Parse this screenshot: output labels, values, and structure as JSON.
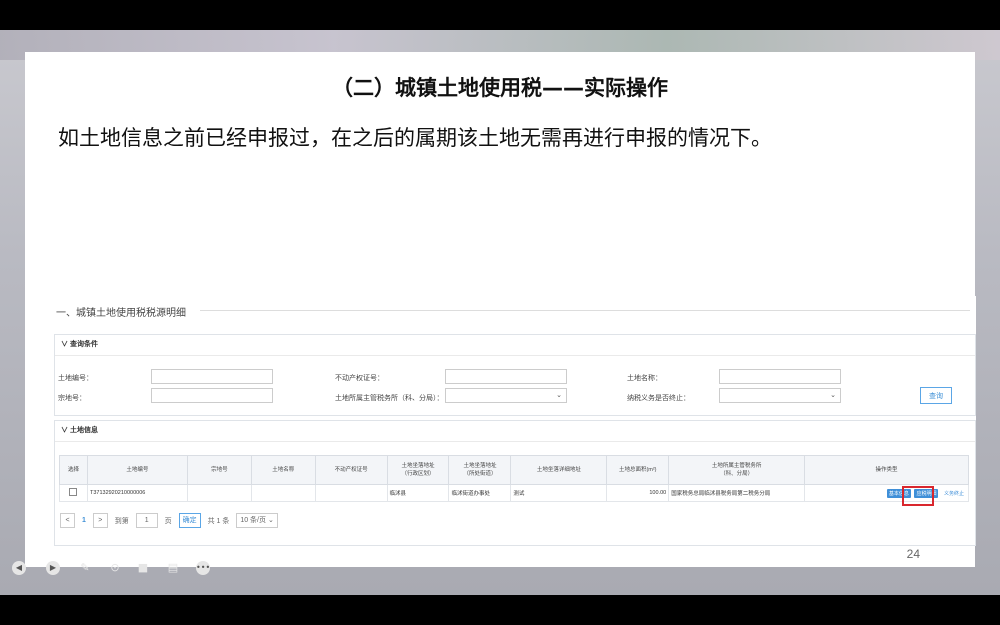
{
  "slide": {
    "title": "（二）城镇土地使用税——实际操作",
    "subtitle": "如土地信息之前已经申报过，在之后的属期该土地无需再进行申报的情况下。",
    "page_number": "24"
  },
  "screenshot": {
    "section_title": "一、城镇土地使用税税源明细",
    "query_panel": {
      "header": "∨ 查询条件",
      "labels": {
        "land_no": "土地编号：",
        "cert_no": "不动产权证号：",
        "land_name": "土地名称：",
        "parcel_no": "宗地号：",
        "tax_office": "土地所属主管税务所（科、分局）：",
        "tax_stopped": "纳税义务是否终止："
      },
      "query_button": "查询"
    },
    "land_panel": {
      "header": "∨ 土地信息",
      "columns": [
        "选择",
        "土地编号",
        "宗地号",
        "土地名称",
        "不动产权证号",
        "土地坐落地址\n（行政区划）",
        "土地坐落地址\n（所处街道）",
        "土地坐落详细地址",
        "土地总面积(m²)",
        "土地所属主管税务所\n（科、分局）",
        "操作类型"
      ],
      "rows": [
        {
          "land_no": "T37132920210000006",
          "parcel_no": "",
          "land_name": "",
          "cert_no": "",
          "district": "临沭县",
          "street": "临沭街道办事处",
          "detail_address": "测试",
          "area": "100.00",
          "tax_office": "国家税务总局临沭县税务局第二税务分局",
          "actions": {
            "basic_info": "基本信息",
            "tax_details": "应税明细",
            "terminate": "义务终止"
          }
        }
      ]
    },
    "pagination": {
      "prev": "<",
      "current": "1",
      "next": ">",
      "goto_label": "到第",
      "goto_value": "1",
      "page_unit": "页",
      "confirm": "确定",
      "total": "共 1 条",
      "page_size": "10 条/页"
    }
  },
  "toolbar": {
    "icons": [
      "prev-slide-icon",
      "next-slide-icon",
      "pen-icon",
      "zoom-icon",
      "camera-icon",
      "subtitle-icon",
      "more-icon"
    ]
  }
}
